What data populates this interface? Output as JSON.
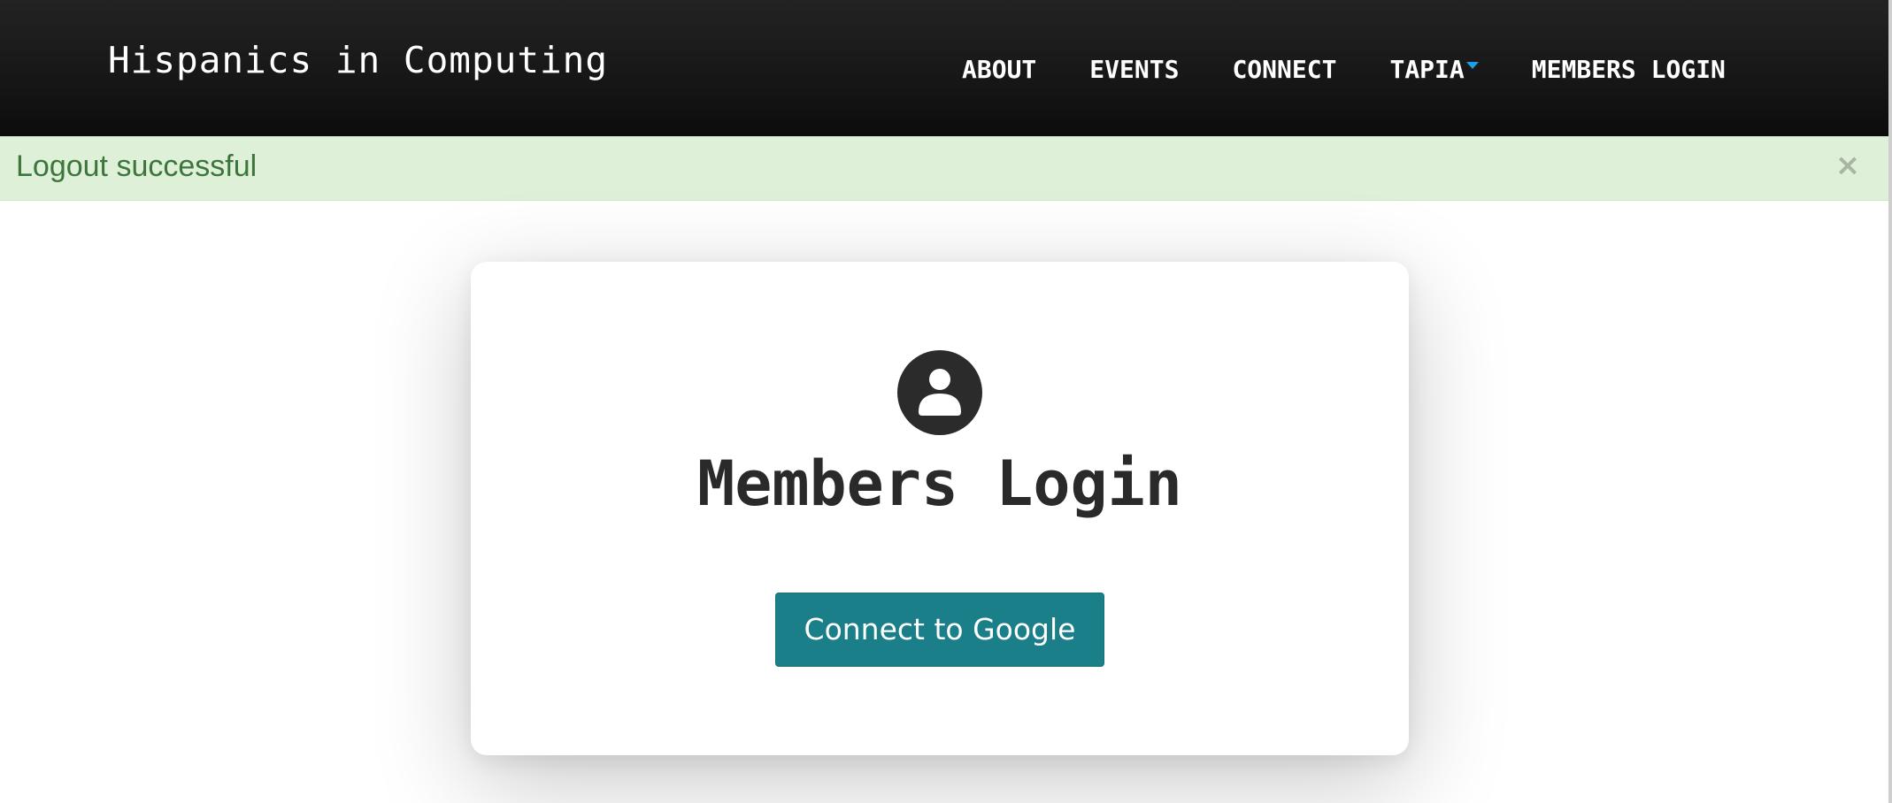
{
  "navbar": {
    "brand": "Hispanics in Computing",
    "items": [
      {
        "label": "ABOUT"
      },
      {
        "label": "EVENTS"
      },
      {
        "label": "CONNECT"
      },
      {
        "label": "TAPIA",
        "has_dropdown": true
      },
      {
        "label": "MEMBERS LOGIN"
      }
    ],
    "dropdown_caret_color": "#1aa0e6"
  },
  "alert": {
    "message": "Logout successful",
    "close_icon": "×",
    "background_color": "#dff0d8",
    "text_color": "#3c763d"
  },
  "login_card": {
    "icon": "user-avatar-icon",
    "title": "Members Login",
    "button_label": "Connect to Google",
    "button_color": "#1b7f89"
  }
}
